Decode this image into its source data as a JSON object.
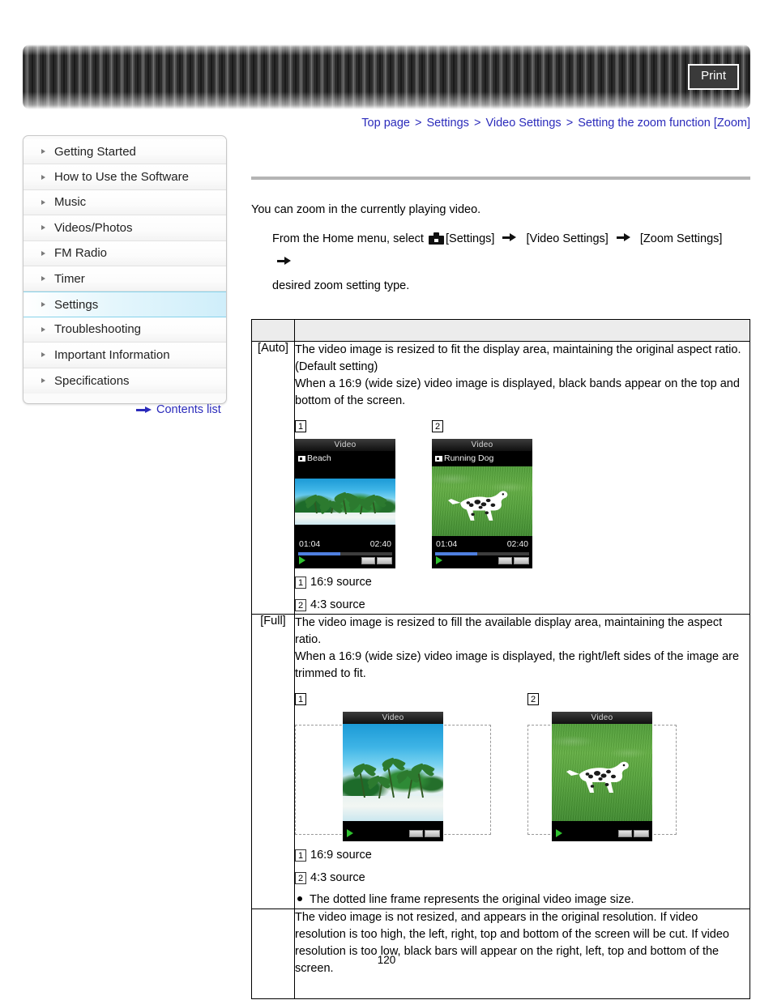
{
  "header": {
    "print_label": "Print"
  },
  "breadcrumb": {
    "items": [
      "Top page",
      "Settings",
      "Video Settings",
      "Setting the zoom function [Zoom]"
    ],
    "separator": ">"
  },
  "sidebar": {
    "items": [
      {
        "label": "Getting Started",
        "active": false
      },
      {
        "label": "How to Use the Software",
        "active": false
      },
      {
        "label": "Music",
        "active": false
      },
      {
        "label": "Videos/Photos",
        "active": false
      },
      {
        "label": "FM Radio",
        "active": false
      },
      {
        "label": "Timer",
        "active": false
      },
      {
        "label": "Settings",
        "active": true
      },
      {
        "label": "Troubleshooting",
        "active": false
      },
      {
        "label": "Important Information",
        "active": false
      },
      {
        "label": "Specifications",
        "active": false
      }
    ],
    "contents_list_label": "Contents list"
  },
  "main": {
    "intro": "You can zoom in the currently playing video.",
    "procedure": {
      "prefix": "From the Home menu, select",
      "icon": "toolbox-icon",
      "step1": "[Settings]",
      "step2": "[Video Settings]",
      "step3": "[Zoom Settings]",
      "suffix": "desired zoom setting type."
    },
    "table": {
      "header_mode": "",
      "header_desc": "",
      "rows": [
        {
          "mode": "[Auto]",
          "desc_lines": [
            "The video image is resized to fit the display area, maintaining the original aspect ratio.",
            "(Default setting)",
            "When a 16:9 (wide size) video image is displayed, black bands appear on the top and",
            "bottom of the screen."
          ],
          "figures": [
            {
              "badge": "1",
              "screen_title": "Video",
              "track_title": "Beach",
              "time_elapsed": "01:04",
              "time_total": "02:40",
              "progress_percent": 45,
              "art": "beach",
              "letterboxed": true
            },
            {
              "badge": "2",
              "screen_title": "Video",
              "track_title": "Running Dog",
              "time_elapsed": "01:04",
              "time_total": "02:40",
              "progress_percent": 45,
              "art": "grass",
              "letterboxed": false
            }
          ],
          "captions": [
            {
              "badge": "1",
              "text": "16:9 source"
            },
            {
              "badge": "2",
              "text": "4:3 source"
            }
          ],
          "notes": []
        },
        {
          "mode": "[Full]",
          "desc_lines": [
            "The video image is resized to fill the available display area, maintaining the aspect",
            "ratio.",
            "When a 16:9 (wide size) video image is displayed, the right/left sides of the image are",
            "trimmed to fit."
          ],
          "figures": [
            {
              "badge": "1",
              "screen_title": "Video",
              "track_title": "",
              "time_elapsed": "",
              "time_total": "",
              "progress_percent": 0,
              "art": "beach",
              "letterboxed": false
            },
            {
              "badge": "2",
              "screen_title": "Video",
              "track_title": "",
              "time_elapsed": "",
              "time_total": "",
              "progress_percent": 0,
              "art": "grass",
              "letterboxed": false
            }
          ],
          "captions": [
            {
              "badge": "1",
              "text": "16:9 source"
            },
            {
              "badge": "2",
              "text": "4:3 source"
            }
          ],
          "notes": [
            "The dotted line frame represents the original video image size."
          ]
        },
        {
          "mode": "",
          "desc_lines": [
            "The video image is not resized, and appears in the original resolution. If video",
            "resolution is too high, the left, right, top and bottom of the screen will be cut. If video",
            "resolution is too low, black bars will appear on the right, left, top and bottom of the",
            "screen."
          ],
          "figures": [],
          "captions": [],
          "notes": []
        }
      ]
    }
  },
  "footer": {
    "page_number": "120"
  },
  "colors": {
    "link": "#2b2bbb",
    "active_nav": "#cfeefa",
    "rule": "#b4b4b4",
    "table_header_bg": "#ececec",
    "progress": "#4f7fe0",
    "play": "#2fc22f"
  }
}
